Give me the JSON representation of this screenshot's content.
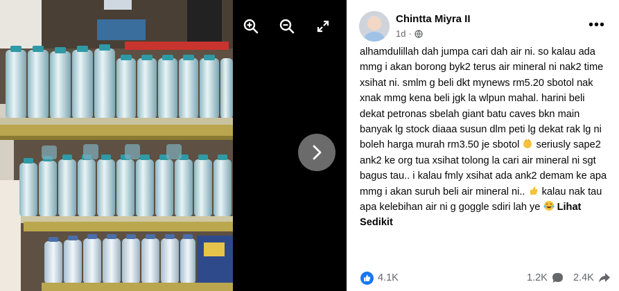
{
  "viewer": {
    "zoom_in_icon": "zoom-in-icon",
    "zoom_out_icon": "zoom-out-icon",
    "fullscreen_icon": "expand-icon",
    "next_icon": "chevron-right-icon"
  },
  "post": {
    "author": "Chintta Miyra II",
    "time": "1d",
    "audience_icon": "globe-icon",
    "more_label": "•••",
    "text_part1": "alhamdulillah dah jumpa cari dah air ni. so kalau ada mmg i akan borong byk2 terus air mineral ni nak2 time xsihat ni. smlm g beli dkt mynews rm5.20 sbotol nak xnak mmg kena beli jgk la wlpun mahal. harini beli dekat petronas sbelah giant batu caves bkn main banyak lg stock diaaa susun dlm peti lg dekat rak lg ni boleh harga murah rm3.50 je sbotol",
    "text_part2": " seriusly sape2 ank2 ke org tua xsihat tolong la cari air mineral ni sgt bagus tau.. i kalau fmly xsihat ada ank2 demam ke apa mmg i akan suruh beli air mineral ni..",
    "text_part3": " kalau nak tau apa kelebihan air ni g goggle sdiri lah ye",
    "see_more": "Lihat Sedikit",
    "emoji1": "clapping-hands-emoji",
    "emoji2": "thumbs-up-emoji",
    "emoji3": "laughing-emoji"
  },
  "stats": {
    "likes": "4.1K",
    "comments": "1.2K",
    "shares": "2.4K",
    "like_icon": "like-icon",
    "comment_icon": "comment-icon",
    "share_icon": "share-icon"
  },
  "colors": {
    "accent": "#1877f2",
    "text": "#050505",
    "muted": "#65676b"
  }
}
